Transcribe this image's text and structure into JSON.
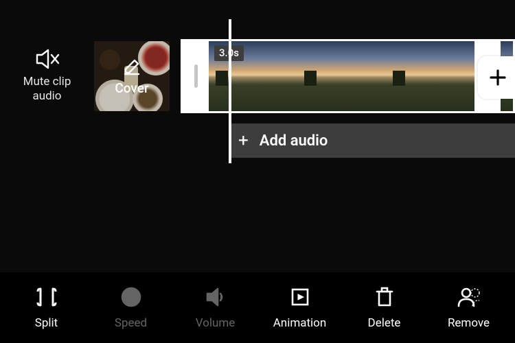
{
  "mute": {
    "label_line1": "Mute clip",
    "label_line2": "audio"
  },
  "cover": {
    "label": "Cover"
  },
  "clip": {
    "duration_label": "3.0s"
  },
  "audio": {
    "add_label": "Add audio"
  },
  "tools": {
    "split": {
      "label": "Split",
      "enabled": true
    },
    "speed": {
      "label": "Speed",
      "enabled": false
    },
    "volume": {
      "label": "Volume",
      "enabled": false
    },
    "animation": {
      "label": "Animation",
      "enabled": true
    },
    "delete": {
      "label": "Delete",
      "enabled": true
    },
    "remove": {
      "label": "Remove",
      "enabled": true
    }
  }
}
